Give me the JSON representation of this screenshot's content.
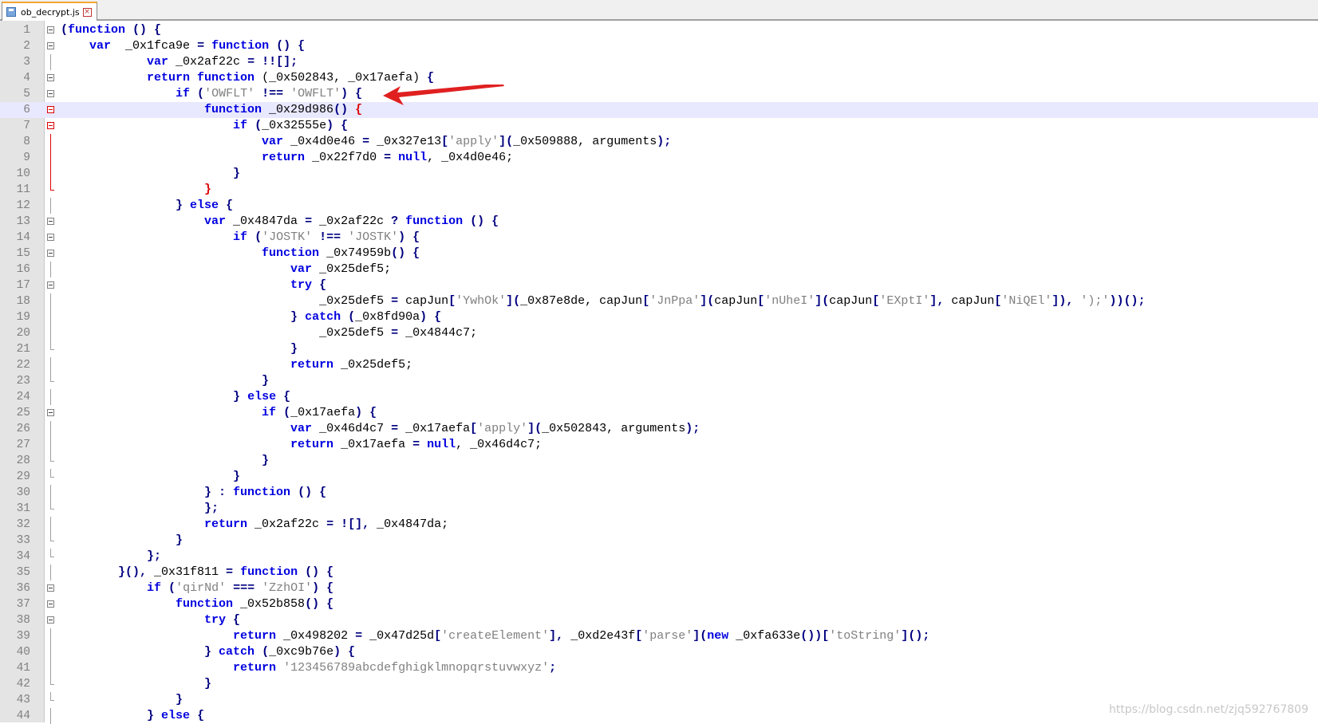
{
  "tab": {
    "filename": "ob_decrypt.js"
  },
  "watermark": "https://blog.csdn.net/zjq592767809",
  "current_line": 6,
  "colors": {
    "keyword": "#0000e0",
    "string": "#808080",
    "tab_accent": "#f2a531",
    "arrow": "#e02020"
  },
  "lines": [
    {
      "n": "1",
      "fold": "box",
      "indent": 0,
      "t": [
        [
          "op",
          "("
        ],
        [
          "kw",
          "function"
        ],
        [
          "op",
          " () {"
        ]
      ]
    },
    {
      "n": "2",
      "fold": "box",
      "indent": 1,
      "t": [
        [
          "kw",
          "var"
        ],
        [
          "",
          "  _0x1fca9e "
        ],
        [
          "op",
          "="
        ],
        [
          "",
          ""
        ],
        [
          "kw",
          " function"
        ],
        [
          "op",
          " () {"
        ]
      ]
    },
    {
      "n": "3",
      "fold": "line",
      "indent": 3,
      "t": [
        [
          "kw",
          "var"
        ],
        [
          "",
          " _0x2af22c "
        ],
        [
          "op",
          "= !![];"
        ]
      ]
    },
    {
      "n": "4",
      "fold": "box",
      "indent": 3,
      "t": [
        [
          "kw",
          "return"
        ],
        [
          "",
          ""
        ],
        [
          "kw",
          " function"
        ],
        [
          "",
          " (_0x502843, _0x17aefa) "
        ],
        [
          "op",
          "{"
        ]
      ]
    },
    {
      "n": "5",
      "fold": "box",
      "indent": 4,
      "t": [
        [
          "kw",
          "if"
        ],
        [
          "op",
          " ("
        ],
        [
          "str",
          "'OWFLT'"
        ],
        [
          "op",
          " !== "
        ],
        [
          "str",
          "'OWFLT'"
        ],
        [
          "op",
          ") {"
        ]
      ]
    },
    {
      "n": "6",
      "fold": "boxred",
      "indent": 5,
      "t": [
        [
          "kw",
          "function"
        ],
        [
          "",
          " _0x29d986"
        ],
        [
          "op",
          "() "
        ],
        [
          "hl",
          "{"
        ]
      ]
    },
    {
      "n": "7",
      "fold": "boxred",
      "indent": 6,
      "t": [
        [
          "kw",
          "if"
        ],
        [
          "op",
          " ("
        ],
        [
          "",
          "_0x32555e"
        ],
        [
          "op",
          ") {"
        ]
      ]
    },
    {
      "n": "8",
      "fold": "linered",
      "indent": 7,
      "t": [
        [
          "kw",
          "var"
        ],
        [
          "",
          " _0x4d0e46 "
        ],
        [
          "op",
          "="
        ],
        [
          "",
          " _0x327e13"
        ],
        [
          "op",
          "["
        ],
        [
          "str",
          "'apply'"
        ],
        [
          "op",
          "]("
        ],
        [
          "",
          "_0x509888, arguments"
        ],
        [
          "op",
          ");"
        ]
      ]
    },
    {
      "n": "9",
      "fold": "linered",
      "indent": 7,
      "t": [
        [
          "kw",
          "return"
        ],
        [
          "",
          " _0x22f7d0 "
        ],
        [
          "op",
          "="
        ],
        [
          "kw",
          " null"
        ],
        [
          "",
          ", _0x4d0e46;"
        ]
      ]
    },
    {
      "n": "10",
      "fold": "linered",
      "indent": 6,
      "t": [
        [
          "op",
          "}"
        ]
      ]
    },
    {
      "n": "11",
      "fold": "endred",
      "indent": 5,
      "t": [
        [
          "hl",
          "}"
        ]
      ]
    },
    {
      "n": "12",
      "fold": "line",
      "indent": 4,
      "t": [
        [
          "op",
          "} "
        ],
        [
          "kw",
          "else"
        ],
        [
          "op",
          " {"
        ]
      ]
    },
    {
      "n": "13",
      "fold": "box",
      "indent": 5,
      "t": [
        [
          "kw",
          "var"
        ],
        [
          "",
          " _0x4847da "
        ],
        [
          "op",
          "="
        ],
        [
          "",
          " _0x2af22c "
        ],
        [
          "op",
          "? "
        ],
        [
          "kw",
          "function"
        ],
        [
          "op",
          " () {"
        ]
      ]
    },
    {
      "n": "14",
      "fold": "box",
      "indent": 6,
      "t": [
        [
          "kw",
          "if"
        ],
        [
          "op",
          " ("
        ],
        [
          "str",
          "'JOSTK'"
        ],
        [
          "op",
          " !== "
        ],
        [
          "str",
          "'JOSTK'"
        ],
        [
          "op",
          ") {"
        ]
      ]
    },
    {
      "n": "15",
      "fold": "box",
      "indent": 7,
      "t": [
        [
          "kw",
          "function"
        ],
        [
          "",
          " _0x74959b"
        ],
        [
          "op",
          "() {"
        ]
      ]
    },
    {
      "n": "16",
      "fold": "line",
      "indent": 8,
      "t": [
        [
          "kw",
          "var"
        ],
        [
          "",
          " _0x25def5;"
        ]
      ]
    },
    {
      "n": "17",
      "fold": "box",
      "indent": 8,
      "t": [
        [
          "kw",
          "try"
        ],
        [
          "op",
          " {"
        ]
      ]
    },
    {
      "n": "18",
      "fold": "line",
      "indent": 9,
      "t": [
        [
          "",
          "_0x25def5 "
        ],
        [
          "op",
          "="
        ],
        [
          "",
          " capJun"
        ],
        [
          "op",
          "["
        ],
        [
          "str",
          "'YwhOk'"
        ],
        [
          "op",
          "]("
        ],
        [
          "",
          "_0x87e8de, capJun"
        ],
        [
          "op",
          "["
        ],
        [
          "str",
          "'JnPpa'"
        ],
        [
          "op",
          "]("
        ],
        [
          "",
          "capJun"
        ],
        [
          "op",
          "["
        ],
        [
          "str",
          "'nUheI'"
        ],
        [
          "op",
          "]("
        ],
        [
          "",
          "capJun"
        ],
        [
          "op",
          "["
        ],
        [
          "str",
          "'EXptI'"
        ],
        [
          "op",
          "], "
        ],
        [
          "",
          "capJun"
        ],
        [
          "op",
          "["
        ],
        [
          "str",
          "'NiQEl'"
        ],
        [
          "op",
          "]), "
        ],
        [
          "str",
          "');'"
        ],
        [
          "op",
          "))();"
        ]
      ]
    },
    {
      "n": "19",
      "fold": "line",
      "indent": 8,
      "t": [
        [
          "op",
          "} "
        ],
        [
          "kw",
          "catch"
        ],
        [
          "op",
          " ("
        ],
        [
          "",
          "_0x8fd90a"
        ],
        [
          "op",
          ") {"
        ]
      ]
    },
    {
      "n": "20",
      "fold": "line",
      "indent": 9,
      "t": [
        [
          "",
          "_0x25def5 "
        ],
        [
          "op",
          "="
        ],
        [
          "",
          " _0x4844c7;"
        ]
      ]
    },
    {
      "n": "21",
      "fold": "end",
      "indent": 8,
      "t": [
        [
          "op",
          "}"
        ]
      ]
    },
    {
      "n": "22",
      "fold": "line",
      "indent": 8,
      "t": [
        [
          "kw",
          "return"
        ],
        [
          "",
          " _0x25def5;"
        ]
      ]
    },
    {
      "n": "23",
      "fold": "end",
      "indent": 7,
      "t": [
        [
          "op",
          "}"
        ]
      ]
    },
    {
      "n": "24",
      "fold": "line",
      "indent": 6,
      "t": [
        [
          "op",
          "} "
        ],
        [
          "kw",
          "else"
        ],
        [
          "op",
          " {"
        ]
      ]
    },
    {
      "n": "25",
      "fold": "box",
      "indent": 7,
      "t": [
        [
          "kw",
          "if"
        ],
        [
          "op",
          " ("
        ],
        [
          "",
          "_0x17aefa"
        ],
        [
          "op",
          ") {"
        ]
      ]
    },
    {
      "n": "26",
      "fold": "line",
      "indent": 8,
      "t": [
        [
          "kw",
          "var"
        ],
        [
          "",
          " _0x46d4c7 "
        ],
        [
          "op",
          "="
        ],
        [
          "",
          " _0x17aefa"
        ],
        [
          "op",
          "["
        ],
        [
          "str",
          "'apply'"
        ],
        [
          "op",
          "]("
        ],
        [
          "",
          "_0x502843, arguments"
        ],
        [
          "op",
          ");"
        ]
      ]
    },
    {
      "n": "27",
      "fold": "line",
      "indent": 8,
      "t": [
        [
          "kw",
          "return"
        ],
        [
          "",
          " _0x17aefa "
        ],
        [
          "op",
          "="
        ],
        [
          "kw",
          " null"
        ],
        [
          "",
          ", _0x46d4c7;"
        ]
      ]
    },
    {
      "n": "28",
      "fold": "end",
      "indent": 7,
      "t": [
        [
          "op",
          "}"
        ]
      ]
    },
    {
      "n": "29",
      "fold": "end",
      "indent": 6,
      "t": [
        [
          "op",
          "}"
        ]
      ]
    },
    {
      "n": "30",
      "fold": "line",
      "indent": 5,
      "t": [
        [
          "op",
          "} : "
        ],
        [
          "kw",
          "function"
        ],
        [
          "op",
          " () {"
        ]
      ]
    },
    {
      "n": "31",
      "fold": "end",
      "indent": 5,
      "t": [
        [
          "op",
          "};"
        ]
      ]
    },
    {
      "n": "32",
      "fold": "line",
      "indent": 5,
      "t": [
        [
          "kw",
          "return"
        ],
        [
          "",
          " _0x2af22c "
        ],
        [
          "op",
          "= ![], "
        ],
        [
          "",
          "_0x4847da;"
        ]
      ]
    },
    {
      "n": "33",
      "fold": "end",
      "indent": 4,
      "t": [
        [
          "op",
          "}"
        ]
      ]
    },
    {
      "n": "34",
      "fold": "end",
      "indent": 3,
      "t": [
        [
          "op",
          "};"
        ]
      ]
    },
    {
      "n": "35",
      "fold": "line",
      "indent": 2,
      "t": [
        [
          "op",
          "}(), "
        ],
        [
          "",
          "_0x31f811 "
        ],
        [
          "op",
          "="
        ],
        [
          "kw",
          " function"
        ],
        [
          "op",
          " () {"
        ]
      ]
    },
    {
      "n": "36",
      "fold": "box",
      "indent": 3,
      "t": [
        [
          "kw",
          "if"
        ],
        [
          "op",
          " ("
        ],
        [
          "str",
          "'qirNd'"
        ],
        [
          "op",
          " === "
        ],
        [
          "str",
          "'ZzhOI'"
        ],
        [
          "op",
          ") {"
        ]
      ]
    },
    {
      "n": "37",
      "fold": "box",
      "indent": 4,
      "t": [
        [
          "kw",
          "function"
        ],
        [
          "",
          " _0x52b858"
        ],
        [
          "op",
          "() {"
        ]
      ]
    },
    {
      "n": "38",
      "fold": "box",
      "indent": 5,
      "t": [
        [
          "kw",
          "try"
        ],
        [
          "op",
          " {"
        ]
      ]
    },
    {
      "n": "39",
      "fold": "line",
      "indent": 6,
      "t": [
        [
          "kw",
          "return"
        ],
        [
          "",
          " _0x498202 "
        ],
        [
          "op",
          "="
        ],
        [
          "",
          " _0x47d25d"
        ],
        [
          "op",
          "["
        ],
        [
          "str",
          "'createElement'"
        ],
        [
          "op",
          "], "
        ],
        [
          "",
          "_0xd2e43f"
        ],
        [
          "op",
          "["
        ],
        [
          "str",
          "'parse'"
        ],
        [
          "op",
          "]("
        ],
        [
          "kw",
          "new"
        ],
        [
          "",
          " _0xfa633e"
        ],
        [
          "op",
          "())["
        ],
        [
          "str",
          "'toString'"
        ],
        [
          "op",
          "]();"
        ]
      ]
    },
    {
      "n": "40",
      "fold": "line",
      "indent": 5,
      "t": [
        [
          "op",
          "} "
        ],
        [
          "kw",
          "catch"
        ],
        [
          "op",
          " ("
        ],
        [
          "",
          "_0xc9b76e"
        ],
        [
          "op",
          ") {"
        ]
      ]
    },
    {
      "n": "41",
      "fold": "line",
      "indent": 6,
      "t": [
        [
          "kw",
          "return"
        ],
        [
          "str",
          " '123456789abcdefghigklmnopqrstuvwxyz'"
        ],
        [
          "op",
          ";"
        ]
      ]
    },
    {
      "n": "42",
      "fold": "end",
      "indent": 5,
      "t": [
        [
          "op",
          "}"
        ]
      ]
    },
    {
      "n": "43",
      "fold": "end",
      "indent": 4,
      "t": [
        [
          "op",
          "}"
        ]
      ]
    },
    {
      "n": "44",
      "fold": "line",
      "indent": 3,
      "t": [
        [
          "op",
          "} "
        ],
        [
          "kw",
          "else"
        ],
        [
          "op",
          " {"
        ]
      ]
    }
  ]
}
